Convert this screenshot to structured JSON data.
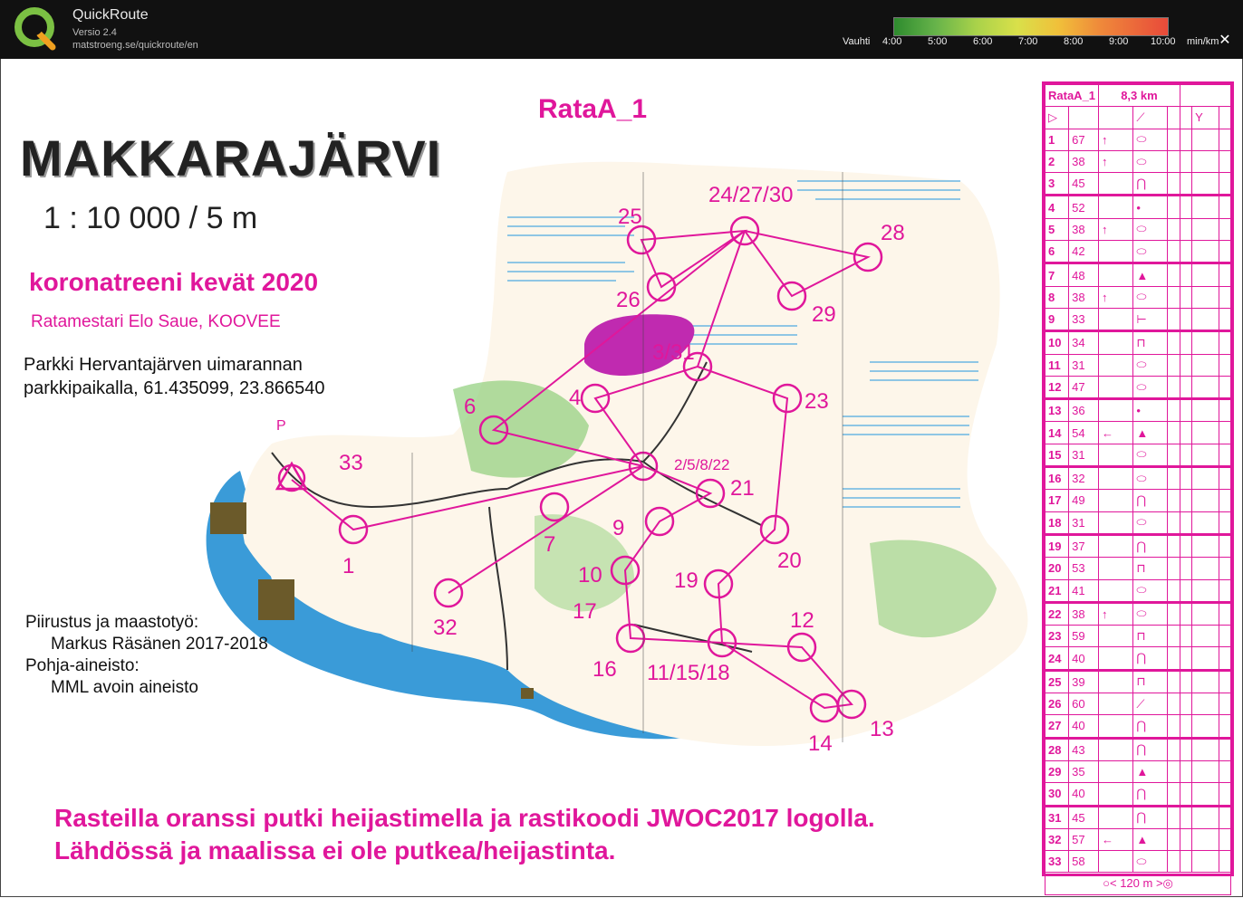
{
  "app": {
    "name": "QuickRoute",
    "version": "Versio 2.4",
    "url": "matstroeng.se/quickroute/en",
    "pace_label": "Vauhti",
    "pace_ticks": [
      "4:00",
      "5:00",
      "6:00",
      "7:00",
      "8:00",
      "9:00",
      "10:00"
    ],
    "pace_unit": "min/km",
    "close_label": "✕"
  },
  "map": {
    "title": "MAKKARAJÄRVI",
    "scale": "1 : 10 000 / 5 m",
    "subtitle": "koronatreeni kevät 2020",
    "setter": "Ratamestari Elo Saue, KOOVEE",
    "parking_line1": "Parkki Hervantajärven uimarannan",
    "parking_line2": "parkkipaikalla, 61.435099, 23.866540",
    "parking_marker": "P",
    "credits_line1": "Piirustus ja maastotyö:",
    "credits_line2": "Markus Räsänen 2017-2018",
    "credits_line3": "Pohja-aineisto:",
    "credits_line4": "MML avoin aineisto",
    "course_name": "RataA_1",
    "note_line1": "Rasteilla oranssi putki heijastimella ja rastikoodi JWOC2017 logolla.",
    "note_line2": "Lähdössä ja maalissa ei ole putkea/heijastinta.",
    "controls": [
      {
        "label": "24/27/30"
      },
      {
        "label": "25"
      },
      {
        "label": "28"
      },
      {
        "label": "26"
      },
      {
        "label": "29"
      },
      {
        "label": "3/31"
      },
      {
        "label": "4"
      },
      {
        "label": "23"
      },
      {
        "label": "6"
      },
      {
        "label": "2/5/8/22"
      },
      {
        "label": "33"
      },
      {
        "label": "21"
      },
      {
        "label": "9"
      },
      {
        "label": "7"
      },
      {
        "label": "20"
      },
      {
        "label": "1"
      },
      {
        "label": "10"
      },
      {
        "label": "19"
      },
      {
        "label": "17"
      },
      {
        "label": "32"
      },
      {
        "label": "12"
      },
      {
        "label": "16"
      },
      {
        "label": "11/15/18"
      },
      {
        "label": "13"
      },
      {
        "label": "14"
      }
    ]
  },
  "description": {
    "course": "RataA_1",
    "length": "8,3 km",
    "footer": "120 m",
    "rows": [
      {
        "n": "1",
        "c": "67",
        "d": "↑",
        "f": "⬭"
      },
      {
        "n": "2",
        "c": "38",
        "d": "↑",
        "f": "⬭"
      },
      {
        "n": "3",
        "c": "45",
        "d": "",
        "f": "⋂"
      },
      {
        "n": "4",
        "c": "52",
        "d": "",
        "f": "•"
      },
      {
        "n": "5",
        "c": "38",
        "d": "↑",
        "f": "⬭"
      },
      {
        "n": "6",
        "c": "42",
        "d": "",
        "f": "⬭"
      },
      {
        "n": "7",
        "c": "48",
        "d": "",
        "f": "▲"
      },
      {
        "n": "8",
        "c": "38",
        "d": "↑",
        "f": "⬭"
      },
      {
        "n": "9",
        "c": "33",
        "d": "",
        "f": "⊢"
      },
      {
        "n": "10",
        "c": "34",
        "d": "",
        "f": "⊓"
      },
      {
        "n": "11",
        "c": "31",
        "d": "",
        "f": "⬭"
      },
      {
        "n": "12",
        "c": "47",
        "d": "",
        "f": "⬭"
      },
      {
        "n": "13",
        "c": "36",
        "d": "",
        "f": "•"
      },
      {
        "n": "14",
        "c": "54",
        "d": "←",
        "f": "▲"
      },
      {
        "n": "15",
        "c": "31",
        "d": "",
        "f": "⬭"
      },
      {
        "n": "16",
        "c": "32",
        "d": "",
        "f": "⬭"
      },
      {
        "n": "17",
        "c": "49",
        "d": "",
        "f": "⋂"
      },
      {
        "n": "18",
        "c": "31",
        "d": "",
        "f": "⬭"
      },
      {
        "n": "19",
        "c": "37",
        "d": "",
        "f": "⋂"
      },
      {
        "n": "20",
        "c": "53",
        "d": "",
        "f": "⊓"
      },
      {
        "n": "21",
        "c": "41",
        "d": "",
        "f": "⬭"
      },
      {
        "n": "22",
        "c": "38",
        "d": "↑",
        "f": "⬭"
      },
      {
        "n": "23",
        "c": "59",
        "d": "",
        "f": "⊓"
      },
      {
        "n": "24",
        "c": "40",
        "d": "",
        "f": "⋂"
      },
      {
        "n": "25",
        "c": "39",
        "d": "",
        "f": "⊓"
      },
      {
        "n": "26",
        "c": "60",
        "d": "",
        "f": "⟋"
      },
      {
        "n": "27",
        "c": "40",
        "d": "",
        "f": "⋂"
      },
      {
        "n": "28",
        "c": "43",
        "d": "",
        "f": "⋂"
      },
      {
        "n": "29",
        "c": "35",
        "d": "",
        "f": "▲"
      },
      {
        "n": "30",
        "c": "40",
        "d": "",
        "f": "⋂"
      },
      {
        "n": "31",
        "c": "45",
        "d": "",
        "f": "⋂"
      },
      {
        "n": "32",
        "c": "57",
        "d": "←",
        "f": "▲"
      },
      {
        "n": "33",
        "c": "58",
        "d": "",
        "f": "⬭"
      }
    ]
  }
}
